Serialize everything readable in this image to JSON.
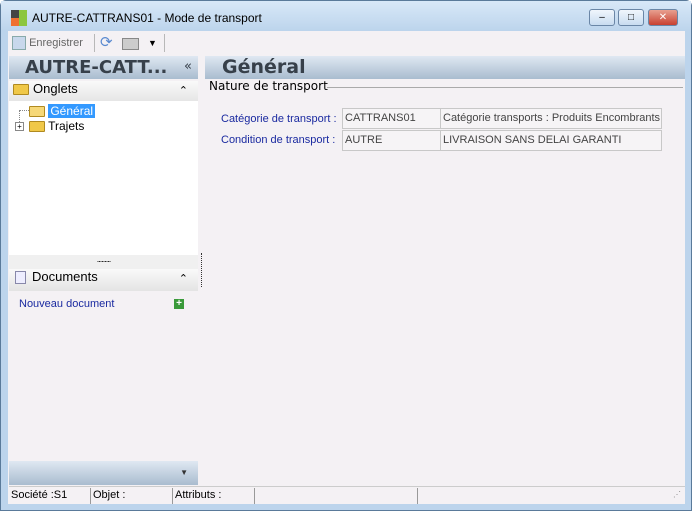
{
  "window": {
    "title": "AUTRE-CATTRANS01 -  Mode de transport",
    "minimize": "–",
    "maximize": "□",
    "close": "✕"
  },
  "toolbar": {
    "save_label": "Enregistrer"
  },
  "left_panel": {
    "title": "AUTRE-CATT...",
    "collapse": "«",
    "onglets": {
      "label": "Onglets",
      "items": [
        {
          "label": "Général",
          "selected": true
        },
        {
          "label": "Trajets",
          "expandable": true
        }
      ]
    },
    "documents": {
      "label": "Documents",
      "new_document": "Nouveau document"
    }
  },
  "main": {
    "title": "Général",
    "group": "Nature de transport",
    "rows": [
      {
        "label": "Catégorie de transport :",
        "code": "CATTRANS01",
        "description": "Catégorie transports :  Produits Encombrants"
      },
      {
        "label": "Condition de transport :",
        "code": "AUTRE",
        "description": "LIVRAISON SANS DELAI GARANTI"
      }
    ]
  },
  "status": {
    "societe": "Société :S1",
    "objet": "Objet :",
    "attributs": "Attributs :"
  },
  "colors": {
    "label": "#1a2aa0",
    "selection": "#3399ff"
  }
}
